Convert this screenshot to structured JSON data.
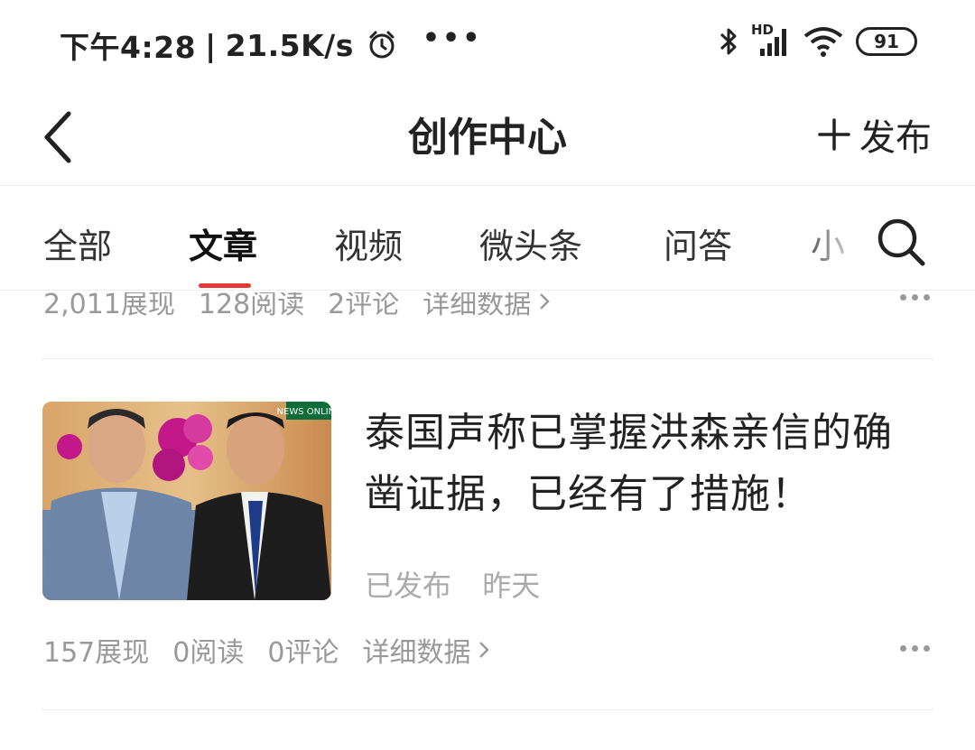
{
  "status_bar": {
    "time": "下午4:28",
    "speed": "21.5K/s",
    "battery": "91",
    "network": "HD"
  },
  "header": {
    "title": "创作中心",
    "publish_label": "发布"
  },
  "tabs": [
    {
      "label": "全部",
      "active": false
    },
    {
      "label": "文章",
      "active": true
    },
    {
      "label": "视频",
      "active": false
    },
    {
      "label": "微头条",
      "active": false
    },
    {
      "label": "问答",
      "active": false
    },
    {
      "label": "小",
      "active": false
    }
  ],
  "previous_item": {
    "impressions": "2,011展现",
    "reads": "128阅读",
    "comments": "2评论",
    "detail": "详细数据"
  },
  "article": {
    "title": "泰国声称已掌握洪森亲信的确凿证据，已经有了措施！",
    "status": "已发布",
    "date": "昨天",
    "thumbnail_badge": "NEWS ONLINE",
    "impressions": "157展现",
    "reads": "0阅读",
    "comments": "0评论",
    "detail": "详细数据"
  },
  "colors": {
    "accent": "#e53935",
    "muted_text": "#999999"
  }
}
